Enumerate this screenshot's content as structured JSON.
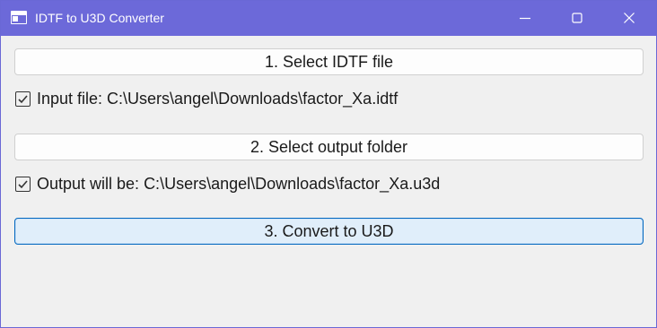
{
  "window": {
    "title": "IDTF to U3D Converter",
    "accent_color": "#6c69d9",
    "icon": "app-window-icon",
    "controls": [
      "minimize-icon",
      "maximize-icon",
      "close-icon"
    ]
  },
  "steps": {
    "select_file_label": "1. Select IDTF file",
    "input_status_label": "Input file:",
    "input_status_path": "C:\\Users\\angel\\Downloads\\factor_Xa.idtf",
    "input_checked": true,
    "select_folder_label": "2. Select output folder",
    "output_status_label": "Output will be:",
    "output_status_path": "C:\\Users\\angel\\Downloads\\factor_Xa.u3d",
    "output_checked": true,
    "convert_label": "3. Convert to U3D"
  }
}
